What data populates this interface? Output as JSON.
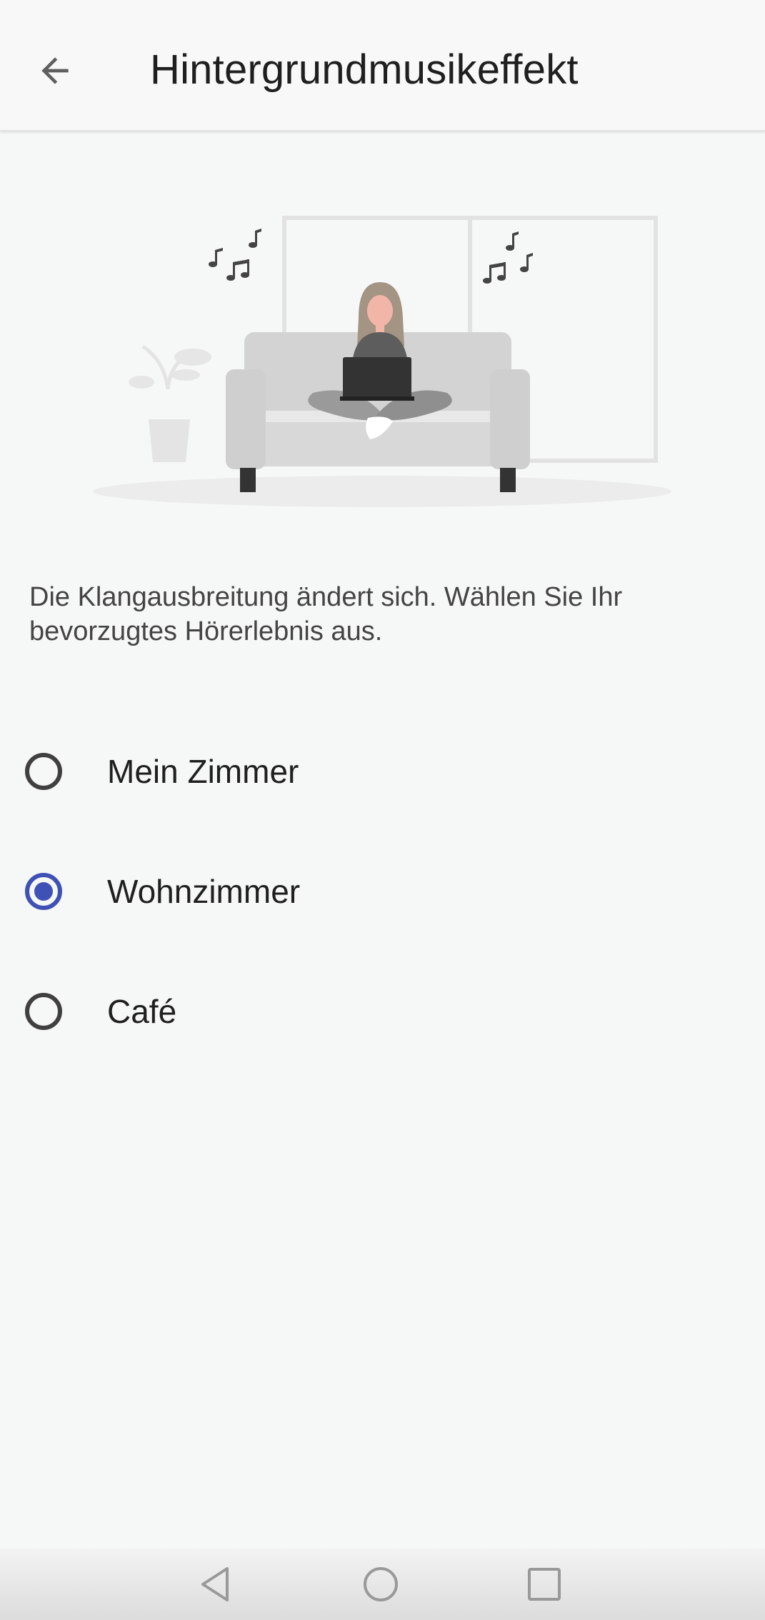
{
  "header": {
    "title": "Hintergrundmusikeffekt",
    "back_icon": "arrow-back-icon"
  },
  "illustration": {
    "icon": "person-on-sofa-with-music-notes-illustration"
  },
  "description": "Die Klangausbreitung ändert sich. Wählen Sie Ihr bevorzugtes Hörerlebnis aus.",
  "options": [
    {
      "label": "Mein Zimmer",
      "selected": false
    },
    {
      "label": "Wohnzimmer",
      "selected": true
    },
    {
      "label": "Café",
      "selected": false
    }
  ],
  "colors": {
    "accent": "#3f51b5",
    "background": "#f6f7f7",
    "title_text": "#1f1f1f"
  },
  "navigation_bar": {
    "back_icon": "triangle-back-icon",
    "home_icon": "circle-home-icon",
    "recents_icon": "square-recents-icon"
  }
}
